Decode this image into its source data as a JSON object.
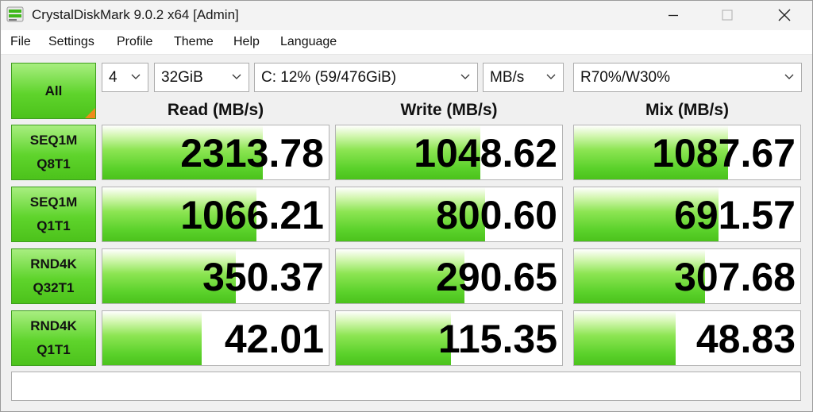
{
  "window": {
    "title": "CrystalDiskMark 9.0.2 x64 [Admin]",
    "icon": "crystaldiskmark-app-icon",
    "controls": [
      "minimize-icon",
      "maximize-icon",
      "close-icon"
    ]
  },
  "menu": {
    "items": [
      "File",
      "Settings",
      "Profile",
      "Theme",
      "Help",
      "Language"
    ]
  },
  "toolbar": {
    "all_label": "All",
    "test_count": "4",
    "test_size": "32GiB",
    "drive": "C: 12% (59/476GiB)",
    "unit": "MB/s",
    "mix_ratio": "R70%/W30%"
  },
  "columns": {
    "read": "Read (MB/s)",
    "write": "Write (MB/s)",
    "mix": "Mix (MB/s)"
  },
  "rows": [
    {
      "line1": "SEQ1M",
      "line2": "Q8T1",
      "read": {
        "value": "2313.78",
        "level": 0.71
      },
      "write": {
        "value": "1048.62",
        "level": 0.64
      },
      "mix": {
        "value": "1087.67",
        "level": 0.68
      }
    },
    {
      "line1": "SEQ1M",
      "line2": "Q1T1",
      "read": {
        "value": "1066.21",
        "level": 0.68
      },
      "write": {
        "value": "800.60",
        "level": 0.66
      },
      "mix": {
        "value": "691.57",
        "level": 0.64
      }
    },
    {
      "line1": "RND4K",
      "line2": "Q32T1",
      "read": {
        "value": "350.37",
        "level": 0.59
      },
      "write": {
        "value": "290.65",
        "level": 0.57
      },
      "mix": {
        "value": "307.68",
        "level": 0.58
      }
    },
    {
      "line1": "RND4K",
      "line2": "Q1T1",
      "read": {
        "value": "42.01",
        "level": 0.44
      },
      "write": {
        "value": "115.35",
        "level": 0.51
      },
      "mix": {
        "value": "48.83",
        "level": 0.45
      }
    }
  ],
  "comment": "",
  "colors": {
    "accent_green": "#5fd42c",
    "corner_orange": "#f08a1a",
    "title_bar": "#f3f3f3"
  }
}
